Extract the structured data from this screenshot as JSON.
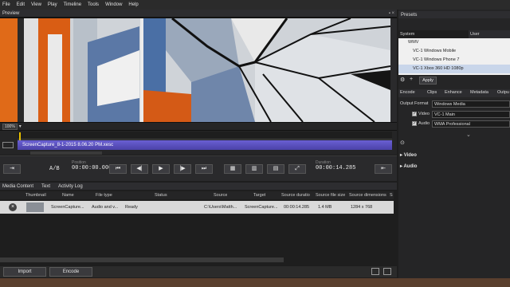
{
  "menu": [
    "File",
    "Edit",
    "View",
    "Play",
    "Timeline",
    "Tools",
    "Window",
    "Help"
  ],
  "preview": {
    "title": "Preview",
    "zoom": "100%"
  },
  "timeline": {
    "clip_name": "ScreenCapture_8-1-2015 8.06.20 PM.xesc"
  },
  "transport": {
    "ab_label": "A/B",
    "position_label": "Position",
    "position_value": "00:00:00.000",
    "duration_label": "Duration",
    "duration_value": "00:00:14.285"
  },
  "media": {
    "tabs": [
      "Media Content",
      "Text",
      "Activity Log"
    ],
    "columns": [
      "Thumbnail",
      "Name",
      "File type",
      "Status",
      "Source",
      "Target",
      "Source duratio",
      "Source file size",
      "Source dimensions",
      "S"
    ],
    "row": {
      "name": "ScreenCapture...",
      "file_type": "Audio and v...",
      "status": "Ready",
      "source": "C:\\Users\\Matth...",
      "target": "ScreenCapture...",
      "duration": "00:00:14.285",
      "file_size": "1.4 MB",
      "dimensions": "1284 x 768"
    },
    "import_label": "Import",
    "encode_label": "Encode"
  },
  "presets": {
    "title": "Presets",
    "tab_system": "System",
    "tab_user": "User",
    "items": [
      "WMV",
      "VC-1 Windows Mobile",
      "VC-1 Windows Phone 7",
      "VC-1 Xbox 360 HD 1080p"
    ],
    "apply_label": "Apply"
  },
  "encode": {
    "tabs": [
      "Encode",
      "Clips",
      "Enhance",
      "Metadata",
      "Outpu"
    ],
    "output_format_label": "Output Format",
    "output_format_value": "Windows Media",
    "video_label": "Video",
    "video_value": "VC-1 Main",
    "audio_label": "Audio",
    "audio_value": "WMA Professional",
    "section_video": "Video",
    "section_audio": "Audio"
  },
  "colors": {
    "clip": "#5a50c0",
    "accent": "#6a5fd3"
  }
}
